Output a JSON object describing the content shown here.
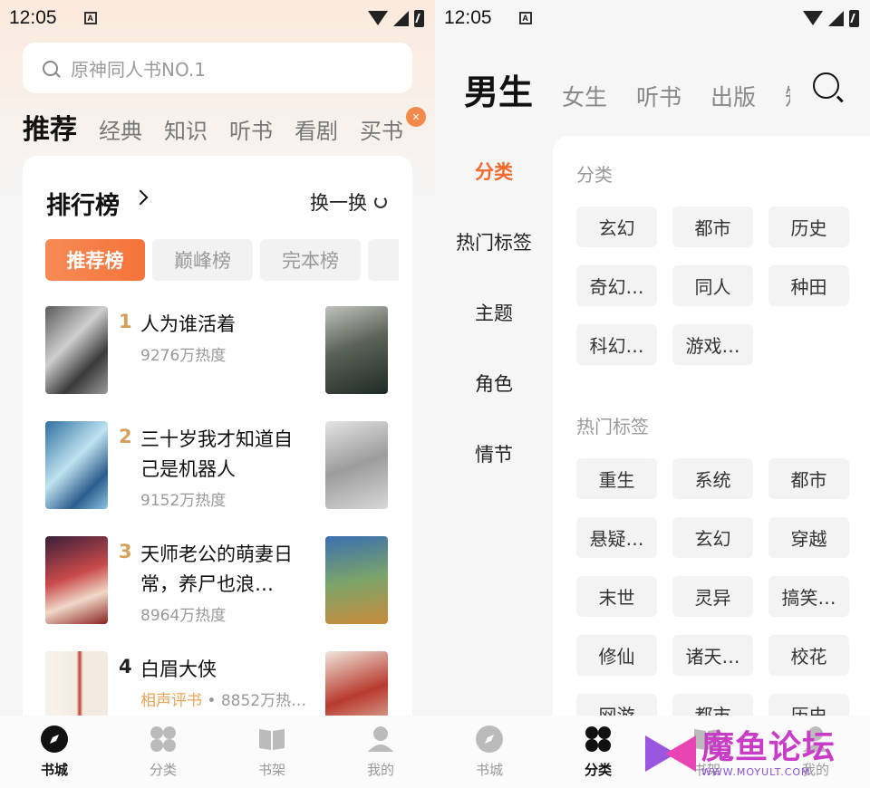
{
  "left": {
    "status": {
      "time": "12:05"
    },
    "search": {
      "placeholder": "原神同人书NO.1"
    },
    "tabs": [
      "推荐",
      "经典",
      "知识",
      "听书",
      "看剧",
      "买书"
    ],
    "ranking": {
      "title": "排行榜",
      "refresh_label": "换一换",
      "tabs": [
        "推荐榜",
        "巅峰榜",
        "完本榜",
        "口"
      ],
      "items": [
        {
          "rank": "1",
          "title": "人为谁活着",
          "heat": "9276万热度",
          "category": ""
        },
        {
          "rank": "2",
          "title": "三十岁我才知道自己是机器人",
          "heat": "9152万热度",
          "category": ""
        },
        {
          "rank": "3",
          "title": "天师老公的萌妻日常，养尸也浪…",
          "heat": "8964万热度",
          "category": ""
        },
        {
          "rank": "4",
          "title": "白眉大侠",
          "heat": " • 8852万热…",
          "category": "相声评书"
        }
      ]
    },
    "nav": [
      "书城",
      "分类",
      "书架",
      "我的"
    ]
  },
  "right": {
    "status": {
      "time": "12:05"
    },
    "gender_tabs": [
      "男生",
      "女生",
      "听书",
      "出版",
      "短"
    ],
    "side": [
      "分类",
      "热门标签",
      "主题",
      "角色",
      "情节"
    ],
    "sections": [
      {
        "title": "分类",
        "tags": [
          "玄幻",
          "都市",
          "历史",
          "奇幻…",
          "同人",
          "种田",
          "科幻…",
          "游戏…"
        ]
      },
      {
        "title": "热门标签",
        "tags": [
          "重生",
          "系统",
          "都市",
          "悬疑…",
          "玄幻",
          "穿越",
          "末世",
          "灵异",
          "搞笑…",
          "修仙",
          "诸天…",
          "校花",
          "网游",
          "都市",
          "历史"
        ]
      }
    ],
    "nav": [
      "书城",
      "分类",
      "书架",
      "我的"
    ]
  },
  "watermark": {
    "title": "魔鱼论坛",
    "url": "WWW.MOYULT.COM"
  },
  "colors": {
    "accent": "#f5733a",
    "rank_gold": "#d5a05c",
    "watermark": "#c93cc8"
  }
}
